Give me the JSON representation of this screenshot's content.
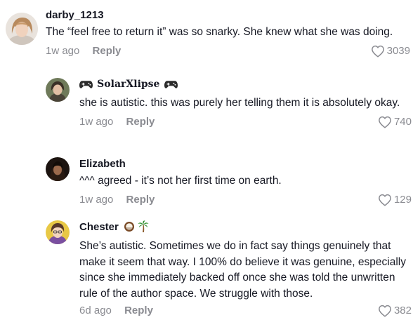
{
  "comments": [
    {
      "username": "darby_1213",
      "text": "The “feel free to return it” was so snarky. She knew what she was doing.",
      "time": "1w ago",
      "reply_label": "Reply",
      "likes": "3039",
      "avatar_icon": "avatar-photo"
    },
    {
      "username": "SolarXlipse",
      "text": "she is autistic. this was purely her telling them it is absolutely okay.",
      "time": "1w ago",
      "reply_label": "Reply",
      "likes": "740",
      "avatar_icon": "avatar-photo",
      "name_icons": [
        "gamepad-icon",
        "gamepad-icon"
      ]
    },
    {
      "username": "Elizabeth",
      "text": "^^^ agreed - it’s not her first time on earth.",
      "time": "1w ago",
      "reply_label": "Reply",
      "likes": "129",
      "avatar_icon": "avatar-photo"
    },
    {
      "username": "Chester",
      "text": "She’s autistic. Sometimes we do in fact say things genuinely that make it seem that way. I 100% do believe it was genuine, especially since she immediately backed off once she was told the unwritten rule of the author space. We struggle with those.",
      "time": "6d ago",
      "reply_label": "Reply",
      "likes": "382",
      "avatar_icon": "avatar-illustration",
      "name_icons": [
        "coconut-icon",
        "palm-tree-icon"
      ]
    }
  ],
  "colors": {
    "text": "#161823",
    "muted": "#8a8b91",
    "background": "#ffffff"
  }
}
